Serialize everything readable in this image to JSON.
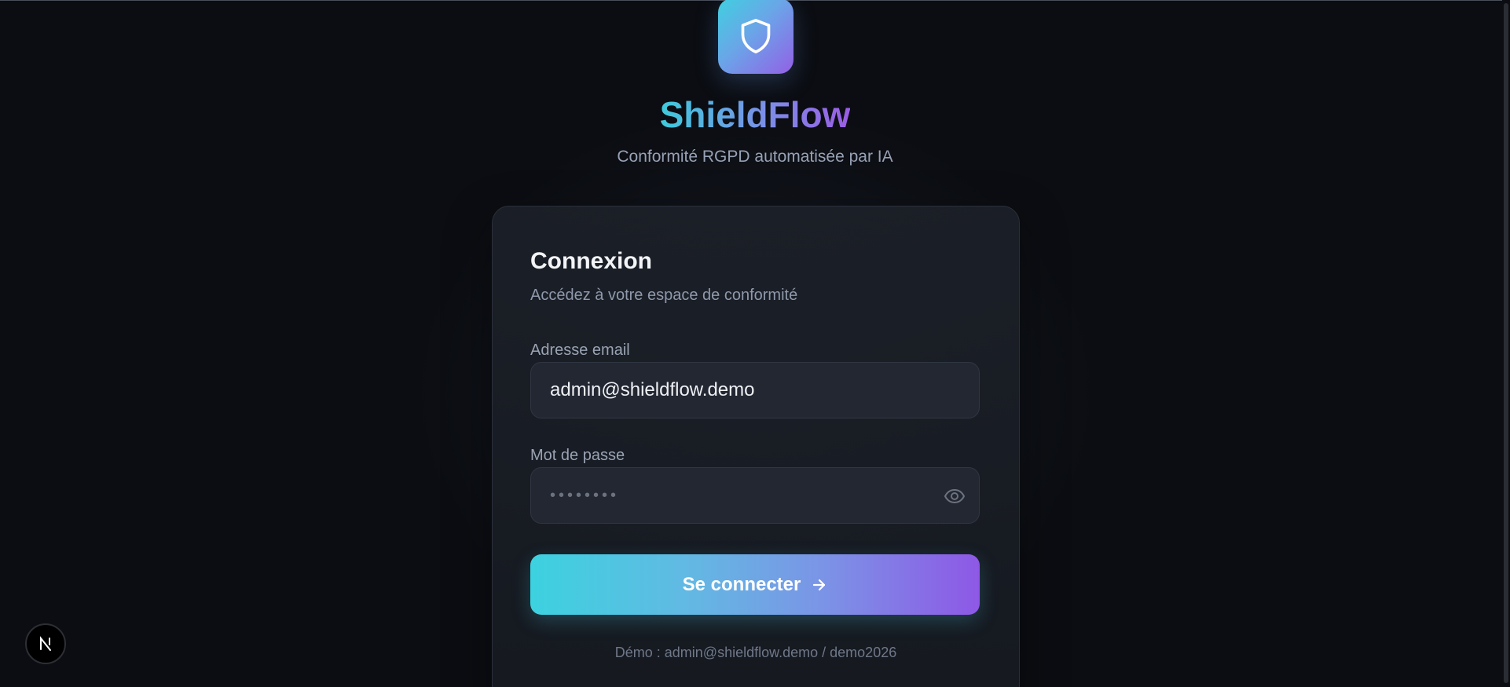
{
  "brand": {
    "name": "ShieldFlow",
    "tagline": "Conformité RGPD automatisée par IA",
    "logo_icon": "shield-icon"
  },
  "login_card": {
    "title": "Connexion",
    "subtitle": "Accédez à votre espace de conformité",
    "email": {
      "label": "Adresse email",
      "value": "admin@shieldflow.demo"
    },
    "password": {
      "label": "Mot de passe",
      "value": "••••••••",
      "toggle_icon": "eye-icon"
    },
    "submit": {
      "label": "Se connecter",
      "icon": "arrow-right-icon"
    },
    "demo_hint": "Démo : admin@shieldflow.demo / demo2026"
  },
  "dev_badge": {
    "label": "N",
    "icon": "nextjs-icon"
  },
  "colors": {
    "background": "#0b0d12",
    "accent_start": "#3cd2e0",
    "accent_end": "#8e58e6",
    "card": "#1c2028"
  }
}
